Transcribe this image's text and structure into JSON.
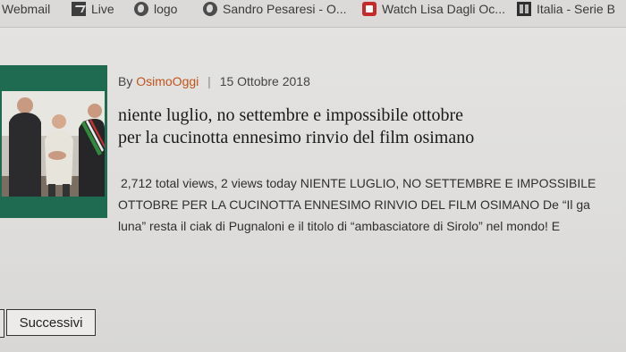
{
  "bookmarks": [
    {
      "label": "Webmail",
      "icon": "none"
    },
    {
      "label": "Live",
      "icon": "arrow-icon"
    },
    {
      "label": "logo",
      "icon": "globe-icon"
    },
    {
      "label": "Sandro Pesaresi - O...",
      "icon": "globe-icon"
    },
    {
      "label": "Watch Lisa Dagli Oc...",
      "icon": "red-square-icon"
    },
    {
      "label": "Italia - Serie B",
      "icon": "grid-icon"
    }
  ],
  "post": {
    "by_label": "By",
    "author": "OsimoOggi",
    "separator": "|",
    "date": "15 Ottobre 2018",
    "title_lines": [
      "niente luglio, no settembre e impossibile ottobre",
      "per la cucinotta ennesimo rinvio del film osimano"
    ],
    "excerpt_lines": [
      "2,712 total views,  2 views today NIENTE LUGLIO, NO SETTEMBRE E IMPOSSIBILE",
      "OTTOBRE PER LA CUCINOTTA ENNESIMO RINVIO DEL FILM OSIMANO De “Il ga",
      "luna” resta il ciak di Pugnaloni e il titolo di “ambasciatore di Sirolo” nel mondo! E"
    ]
  },
  "pagination": {
    "next_label": "Successivi"
  },
  "colors": {
    "author_link": "#c0541a",
    "thumbnail_frame": "#1e6b52"
  }
}
